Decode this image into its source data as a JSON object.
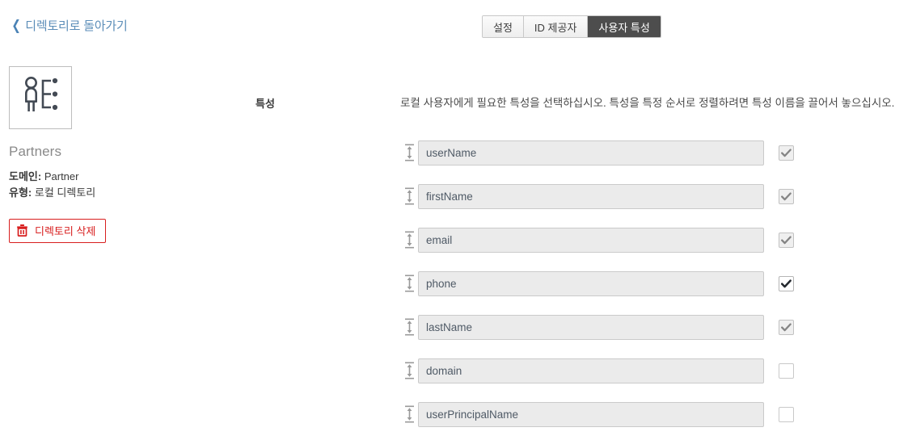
{
  "topbar": {
    "back_label": "디렉토리로 돌아가기",
    "back_icon": "chevron-left-icon"
  },
  "tabs": [
    {
      "label": "설정",
      "active": false
    },
    {
      "label": "ID 제공자",
      "active": false
    },
    {
      "label": "사용자 특성",
      "active": true
    }
  ],
  "sidebar": {
    "icon": "directory-user-icon",
    "title": "Partners",
    "meta": [
      {
        "key": "도메인:",
        "value": "Partner"
      },
      {
        "key": "유형:",
        "value": "로컬 디렉토리"
      }
    ],
    "delete_button": {
      "label": "디렉토리 삭제",
      "icon": "trash-icon",
      "color": "#d81e1e"
    }
  },
  "main": {
    "section_label": "특성",
    "description": "로컬 사용자에게 필요한 특성을 선택하십시오. 특성을 특정 순서로 정렬하려면 특성 이름을 끌어서 놓으십시오.",
    "attributes": [
      {
        "name": "userName",
        "checked": true,
        "locked": true
      },
      {
        "name": "firstName",
        "checked": true,
        "locked": true
      },
      {
        "name": "email",
        "checked": true,
        "locked": true
      },
      {
        "name": "phone",
        "checked": true,
        "locked": false
      },
      {
        "name": "lastName",
        "checked": true,
        "locked": true
      },
      {
        "name": "domain",
        "checked": false,
        "locked": false
      },
      {
        "name": "userPrincipalName",
        "checked": false,
        "locked": false
      }
    ],
    "drag_handle_icon": "drag-vertical-icon",
    "checkbox_icon": "checkmark-icon"
  }
}
